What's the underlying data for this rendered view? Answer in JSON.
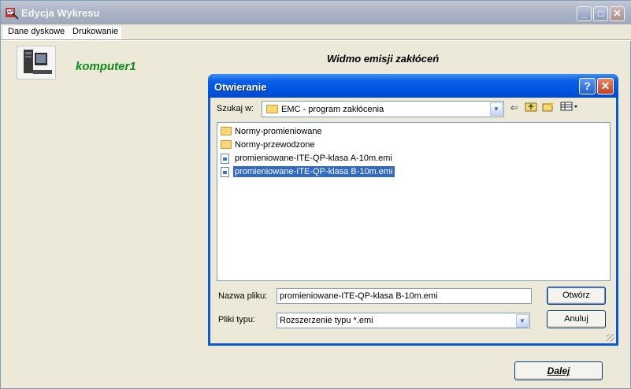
{
  "window": {
    "title": "Edycja Wykresu",
    "minimize": "_",
    "maximize": "□",
    "close": "✕"
  },
  "menu": {
    "items": [
      "Dane dyskowe",
      "Drukowanie"
    ]
  },
  "main": {
    "computer_name": "komputer1",
    "chart_title": "Widmo emisji zakłóceń",
    "next_button": "Dalej"
  },
  "dialog": {
    "title": "Otwieranie",
    "help": "?",
    "close": "✕",
    "look_in_label": "Szukaj w:",
    "look_in_value": "EMC - program zakłócenia",
    "files": [
      {
        "name": "Normy-promieniowane",
        "type": "folder",
        "selected": false
      },
      {
        "name": "Normy-przewodzone",
        "type": "folder",
        "selected": false
      },
      {
        "name": "promieniowane-ITE-QP-klasa A-10m.emi",
        "type": "file",
        "selected": false
      },
      {
        "name": "promieniowane-ITE-QP-klasa B-10m.emi",
        "type": "file",
        "selected": true
      }
    ],
    "filename_label": "Nazwa pliku:",
    "filename_value": "promieniowane-ITE-QP-klasa B-10m.emi",
    "filetype_label": "Pliki typu:",
    "filetype_value": "Rozszerzenie typu *.emi",
    "open_button": "Otwórz",
    "cancel_button": "Anuluj"
  },
  "colors": {
    "dialog_title_bar": "#0054E3",
    "inactive_title_bar": "#9FA8BA",
    "selection": "#316AC5",
    "computer_name": "#0C8A1A"
  }
}
